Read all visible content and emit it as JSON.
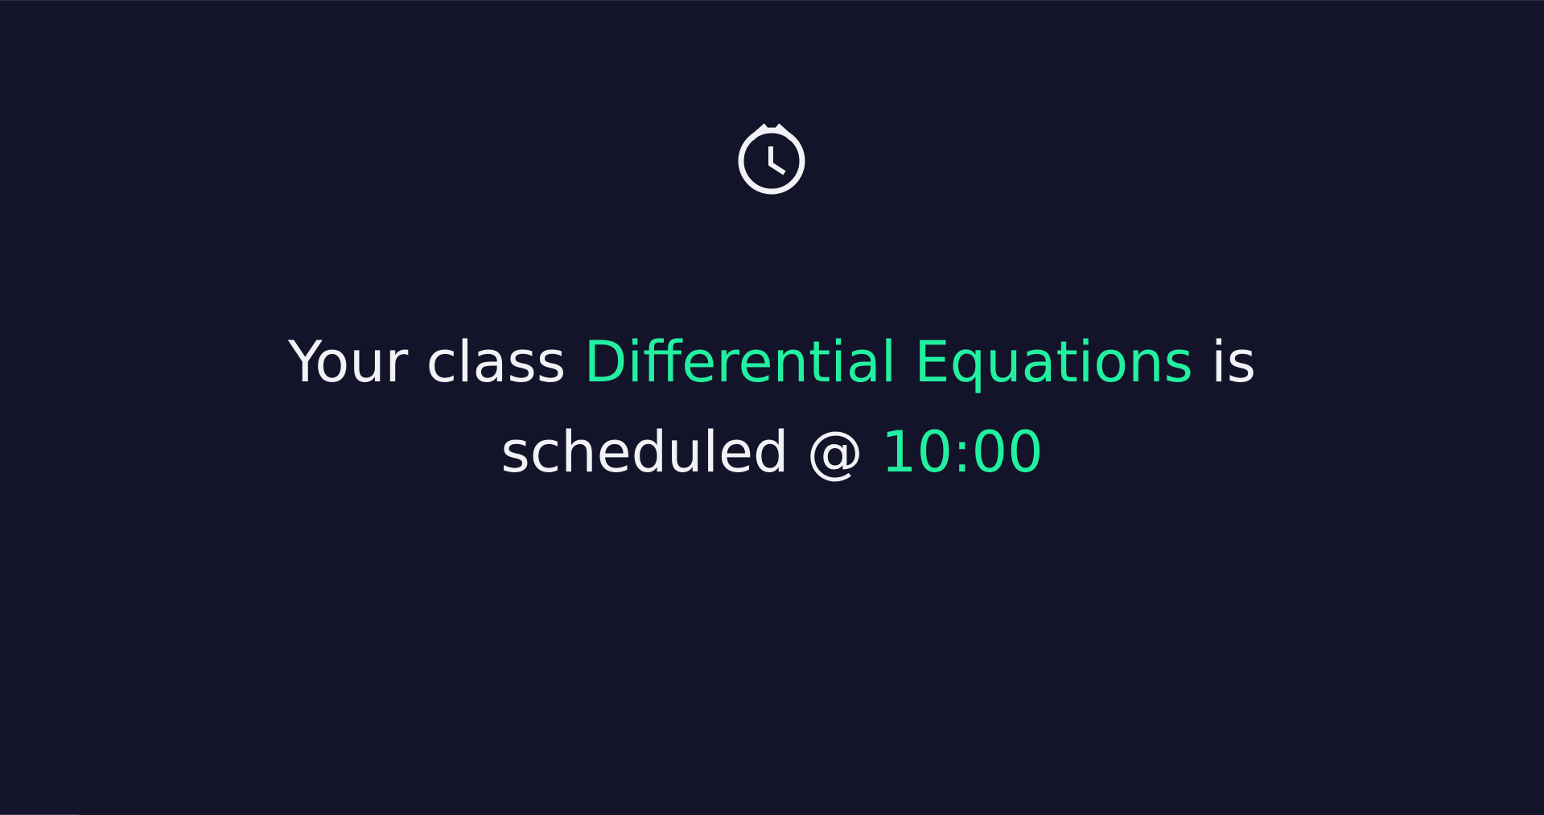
{
  "colors": {
    "background": "#13142a",
    "text": "#f2f2f6",
    "accent": "#22f0a0"
  },
  "icon": "alarm-clock-icon",
  "notification": {
    "prefix": "Your class ",
    "class_name": "Differential Equations",
    "middle": " is scheduled @ ",
    "time": "10:00"
  }
}
